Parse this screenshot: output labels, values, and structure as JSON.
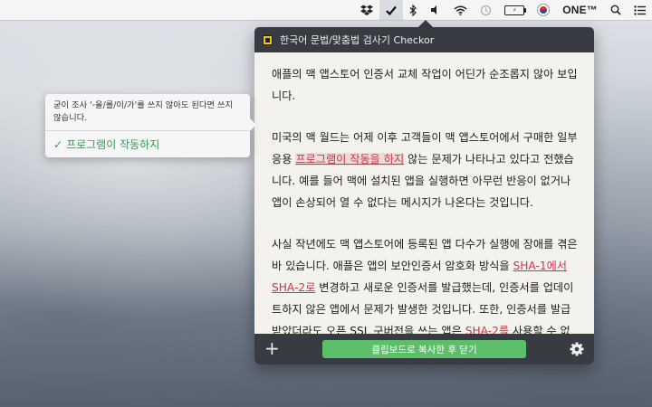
{
  "menubar": {
    "items": [
      {
        "name": "dropbox-icon"
      },
      {
        "name": "checkor-icon"
      },
      {
        "name": "bluetooth-icon"
      },
      {
        "name": "volume-icon"
      },
      {
        "name": "wifi-icon"
      },
      {
        "name": "time-machine-icon"
      },
      {
        "name": "battery-icon"
      },
      {
        "name": "korean-flag-icon"
      }
    ],
    "user_label": "ONE™",
    "battery_text": "⚡"
  },
  "popover": {
    "title": "한국어 문법/맞춤법 검사기 Checkor",
    "paragraphs": [
      {
        "segments": [
          {
            "text": "애플의 맥 앱스토어 인증서 교체 작업이 어딘가 순조롭지 않아 보입니다.",
            "error": false
          }
        ]
      },
      {
        "segments": [
          {
            "text": "미국의 맥 월드는 어제 이후 고객들이 맥 앱스토어에서 구매한 일부 응용 ",
            "error": false
          },
          {
            "text": "프로그램이 작동을 하지",
            "error": true,
            "selected": true
          },
          {
            "text": " 않는 문제가 나타나고 있다고 전했습니다. 예를 들어 맥에 설치된 앱을 실행하면 아무런 반응이 없거나 앱이 손상되어 열 수 없다는 메시지가 나온다는 것입니다.",
            "error": false
          }
        ]
      },
      {
        "segments": [
          {
            "text": "사실 작년에도 맥 앱스토어에 등록된 앱 다수가 실행에 장애를 겪은 바 있습니다. 애플은 앱의 보안인증서 암호화 방식을 ",
            "error": false
          },
          {
            "text": "SHA-1에서",
            "error": true
          },
          {
            "text": " ",
            "error": false
          },
          {
            "text": "SHA-2로",
            "error": true
          },
          {
            "text": " 변경하고 새로운 인증서를 발급했는데, 인증서를 업데이트하지 않은 앱에서 문제가 발생한 것입니다. 또한, 인증서를 발급받았더라도 오픈 SSL 구버전을 쓰는 앱은 ",
            "error": false
          },
          {
            "text": "SHA-2를",
            "error": true
          },
          {
            "text": " 사용할 수 없어 같은 문제를 겪었습니다.",
            "error": false
          }
        ]
      }
    ],
    "footer": {
      "plus_label": "+",
      "copy_button_label": "클립보드로 복사한 후 닫기"
    }
  },
  "tooltip": {
    "message": "굳이 조사 '-을/를/이/가'를 쓰지 않아도 된다면 쓰지 않습니다.",
    "suggestion": "프로그램이 작동하지",
    "check": "✓"
  },
  "colors": {
    "error": "#d0334a",
    "accent_green": "#5bbf6a",
    "suggestion_green": "#2e9b57",
    "dark_bar": "#383c42"
  }
}
